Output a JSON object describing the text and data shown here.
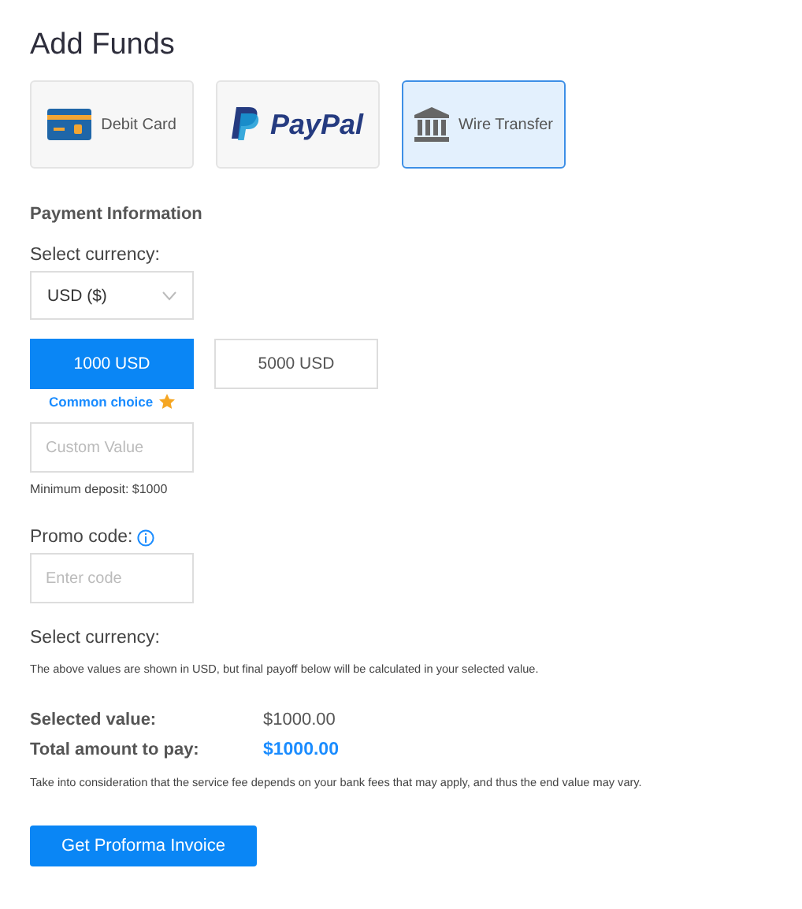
{
  "title": "Add Funds",
  "methods": [
    {
      "kind": "card",
      "label": "Debit Card",
      "selected": false
    },
    {
      "kind": "paypal",
      "label": "PayPal",
      "selected": false
    },
    {
      "kind": "bank",
      "label": "Wire Transfer",
      "selected": true
    }
  ],
  "section_title": "Payment Information",
  "currency": {
    "label": "Select currency:",
    "value": "USD ($)"
  },
  "amounts": [
    {
      "label": "1000 USD",
      "selected": true
    },
    {
      "label": "5000 USD",
      "selected": false
    }
  ],
  "common_choice": "Common choice",
  "custom": {
    "placeholder": "Custom Value",
    "note": "Minimum deposit: $1000"
  },
  "promo": {
    "label": "Promo code:",
    "placeholder": "Enter code"
  },
  "currency_label_2": "Select currency:",
  "currency_note": "The above values are shown in USD, but final payoff below will be calculated in your selected value.",
  "summary": [
    {
      "label": "Selected value:",
      "value": "$1000.00",
      "highlight": false
    },
    {
      "label": "Total amount to pay:",
      "value": "$1000.00",
      "highlight": true
    }
  ],
  "fee_note": "Take into consideration that the service fee depends on your bank fees that may apply, and thus the end value may vary.",
  "submit": "Get Proforma Invoice"
}
